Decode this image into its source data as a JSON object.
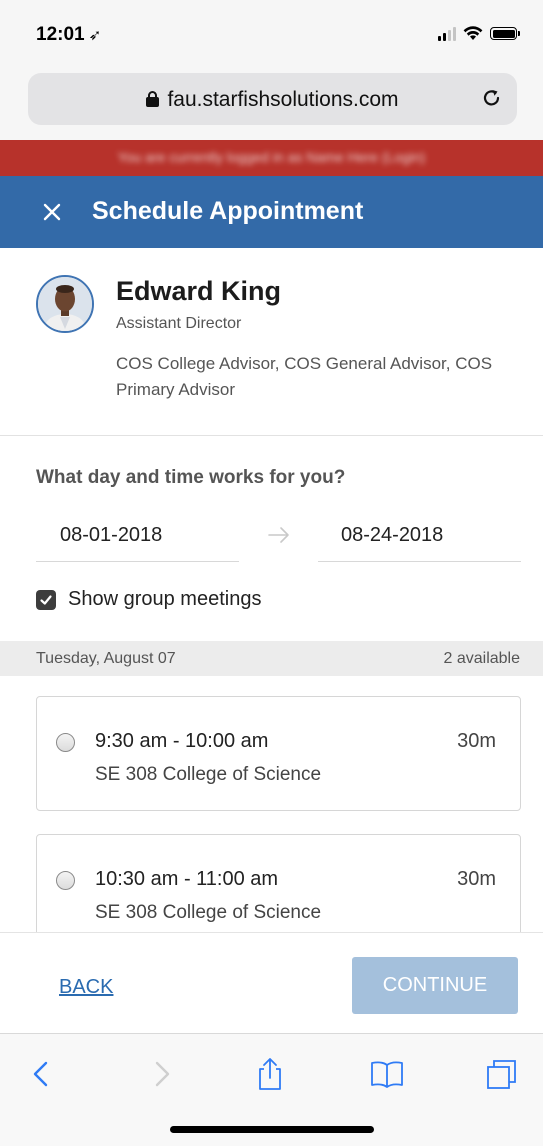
{
  "status_bar": {
    "time": "12:01"
  },
  "browser": {
    "url": "fau.starfishsolutions.com"
  },
  "alert_banner": {
    "text": "You are currently logged in as Name Here (Login)"
  },
  "header": {
    "title": "Schedule Appointment"
  },
  "advisor": {
    "name": "Edward King",
    "title": "Assistant Director",
    "roles": "COS College Advisor, COS General Advisor, COS Primary Advisor"
  },
  "schedule": {
    "question": "What day and time works for you?",
    "start_date": "08-01-2018",
    "end_date": "08-24-2018",
    "show_group_label": "Show group meetings",
    "show_group_checked": true
  },
  "day": {
    "label": "Tuesday, August 07",
    "available": "2 available"
  },
  "slots": [
    {
      "time": "9:30 am - 10:00 am",
      "duration": "30m",
      "location": "SE 308 College of Science"
    },
    {
      "time": "10:30 am - 11:00 am",
      "duration": "30m",
      "location": "SE 308 College of Science"
    }
  ],
  "footer": {
    "back_label": "BACK",
    "continue_label": "CONTINUE"
  },
  "colors": {
    "header": "#336aa8",
    "banner": "#b7322b",
    "link": "#2a6bb0",
    "continue_disabled": "#a4c0dc"
  },
  "icons": [
    "location-arrow-icon",
    "signal-icon",
    "wifi-icon",
    "battery-icon",
    "lock-icon",
    "reload-icon",
    "close-icon",
    "arrow-right-icon",
    "checkbox-checked-icon",
    "radio-icon",
    "back-icon",
    "forward-icon",
    "share-icon",
    "bookmarks-icon",
    "tabs-icon"
  ]
}
